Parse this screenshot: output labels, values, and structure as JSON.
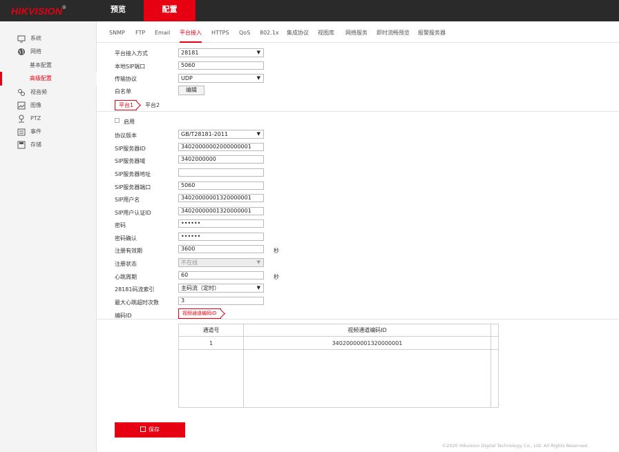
{
  "header": {
    "logo": "HIKVISION",
    "logo_reg": "®",
    "nav": [
      {
        "label": "预览"
      },
      {
        "label": "配置"
      }
    ]
  },
  "sidebar": {
    "items": [
      {
        "label": "系统",
        "icon": "monitor-icon"
      },
      {
        "label": "网络",
        "icon": "globe-icon"
      },
      {
        "label": "视音频",
        "icon": "audio-video-icon"
      },
      {
        "label": "图像",
        "icon": "image-icon"
      },
      {
        "label": "PTZ",
        "icon": "ptz-icon"
      },
      {
        "label": "事件",
        "icon": "event-icon"
      },
      {
        "label": "存储",
        "icon": "storage-icon"
      }
    ],
    "network_sub": [
      {
        "label": "基本配置"
      },
      {
        "label": "高级配置"
      }
    ]
  },
  "subtabs": [
    "SNMP",
    "FTP",
    "Email",
    "平台接入",
    "HTTPS",
    "QoS",
    "802.1x",
    "集成协议",
    "视图库",
    "网络服务",
    "即时流畅预览",
    "报警服务器"
  ],
  "top_form": {
    "access_mode_label": "平台接入方式",
    "access_mode_value": "28181",
    "sip_port_label": "本地SIP端口",
    "sip_port_value": "5060",
    "transport_label": "传输协议",
    "transport_value": "UDP",
    "whitelist_label": "白名单",
    "edit_label": "编辑"
  },
  "platform_tabs": [
    "平台1",
    "平台2"
  ],
  "platform_form": {
    "enable_label": "启用",
    "protocol_label": "协议版本",
    "protocol_value": "GB/T28181-2011",
    "server_id_label": "SIP服务器ID",
    "server_id_value": "34020000002000000001",
    "server_domain_label": "SIP服务器域",
    "server_domain_value": "3402000000",
    "server_addr_label": "SIP服务器地址",
    "server_addr_value": "",
    "server_port_label": "SIP服务器端口",
    "server_port_value": "5060",
    "user_label": "SIP用户名",
    "user_value": "34020000001320000001",
    "auth_label": "SIP用户认证ID",
    "auth_value": "34020000001320000001",
    "password_label": "密码",
    "password_value": "••••••",
    "confirm_label": "密码确认",
    "confirm_value": "••••••",
    "expire_label": "注册有效期",
    "expire_value": "3600",
    "expire_unit": "秒",
    "status_label": "注册状态",
    "status_value": "不在线",
    "heartbeat_label": "心跳周期",
    "heartbeat_value": "60",
    "heartbeat_unit": "秒",
    "stream_label": "28181码流索引",
    "stream_value": "主码流（定时）",
    "timeout_label": "最大心跳超时次数",
    "timeout_value": "3",
    "encode_id_label": "编码ID"
  },
  "encode_tab": "视频通道编码ID",
  "table": {
    "headers": [
      "通道号",
      "视频通道编码ID"
    ],
    "rows": [
      [
        "1",
        "34020000001320000001"
      ]
    ]
  },
  "save_label": "保存",
  "footer": "©2020 Hikvision Digital Technology Co., Ltd. All Rights Reserved."
}
